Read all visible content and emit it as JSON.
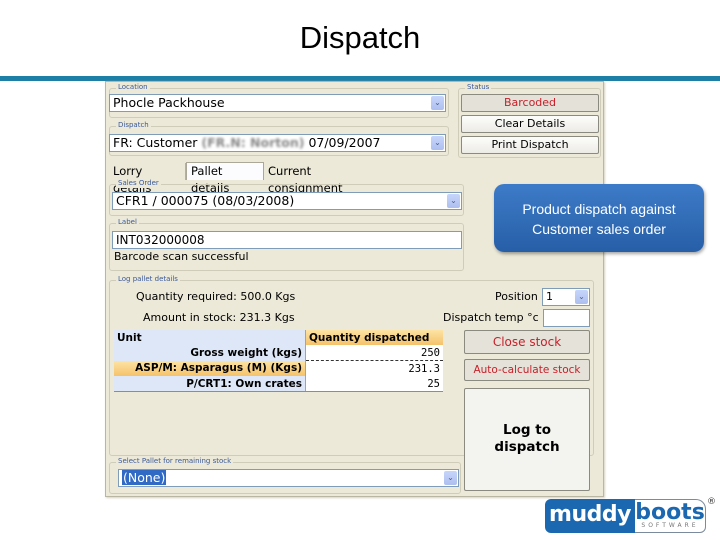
{
  "slide": {
    "title": "Dispatch",
    "accent_color": "#1e7fa6"
  },
  "app": {
    "location": {
      "group_label": "Location",
      "value": "Phocle Packhouse",
      "arrow_icon": "chevron-down-icon"
    },
    "dispatch": {
      "group_label": "Dispatch",
      "value_prefix": "FR: Customer",
      "value_redacted": "(FR.N: Norton)",
      "value_suffix": "07/09/2007",
      "arrow_icon": "chevron-down-icon"
    },
    "status": {
      "group_label": "Status",
      "buttons": [
        "Barcoded",
        "Clear Details",
        "Print Dispatch"
      ],
      "status_color": "#c8202a"
    },
    "tabs": [
      {
        "label": "Lorry details",
        "active": false
      },
      {
        "label": "Pallet details",
        "active": true
      },
      {
        "label": "Current consignment",
        "active": false
      }
    ],
    "sales_order": {
      "group_label": "Sales Order",
      "value": "CFR1 / 000075 (08/03/2008)"
    },
    "label": {
      "group_label": "Label",
      "value": "INT032000008",
      "status_text": "Barcode scan successful"
    },
    "log_pallet": {
      "group_label": "Log pallet details",
      "quantity_required": "Quantity required: 500.0 Kgs",
      "amount_in_stock": "Amount in stock: 231.3 Kgs",
      "position_label": "Position",
      "position_value": "1",
      "temp_label": "Dispatch temp °c",
      "temp_value": "",
      "grid": {
        "headers": [
          "Unit",
          "Quantity dispatched"
        ],
        "rows": [
          {
            "unit": "Gross weight (kgs)",
            "qty": "250"
          },
          {
            "unit": "ASP/M: Asparagus (M) (Kgs)",
            "qty": "231.3"
          },
          {
            "unit": "P/CRT1: Own crates",
            "qty": "25"
          }
        ]
      },
      "buttons": {
        "close_stock": "Close stock",
        "auto_calc": "Auto-calculate stock",
        "log_to_dispatch_line1": "Log to",
        "log_to_dispatch_line2": "dispatch"
      }
    },
    "remaining": {
      "group_label": "Select Pallet for remaining stock",
      "value": "(None)"
    }
  },
  "callout": {
    "line1": "Product dispatch against",
    "line2": "Customer sales order"
  },
  "logo": {
    "part1": "muddy",
    "part2": "boots",
    "tagline": "SOFTWARE",
    "registered": "®"
  }
}
